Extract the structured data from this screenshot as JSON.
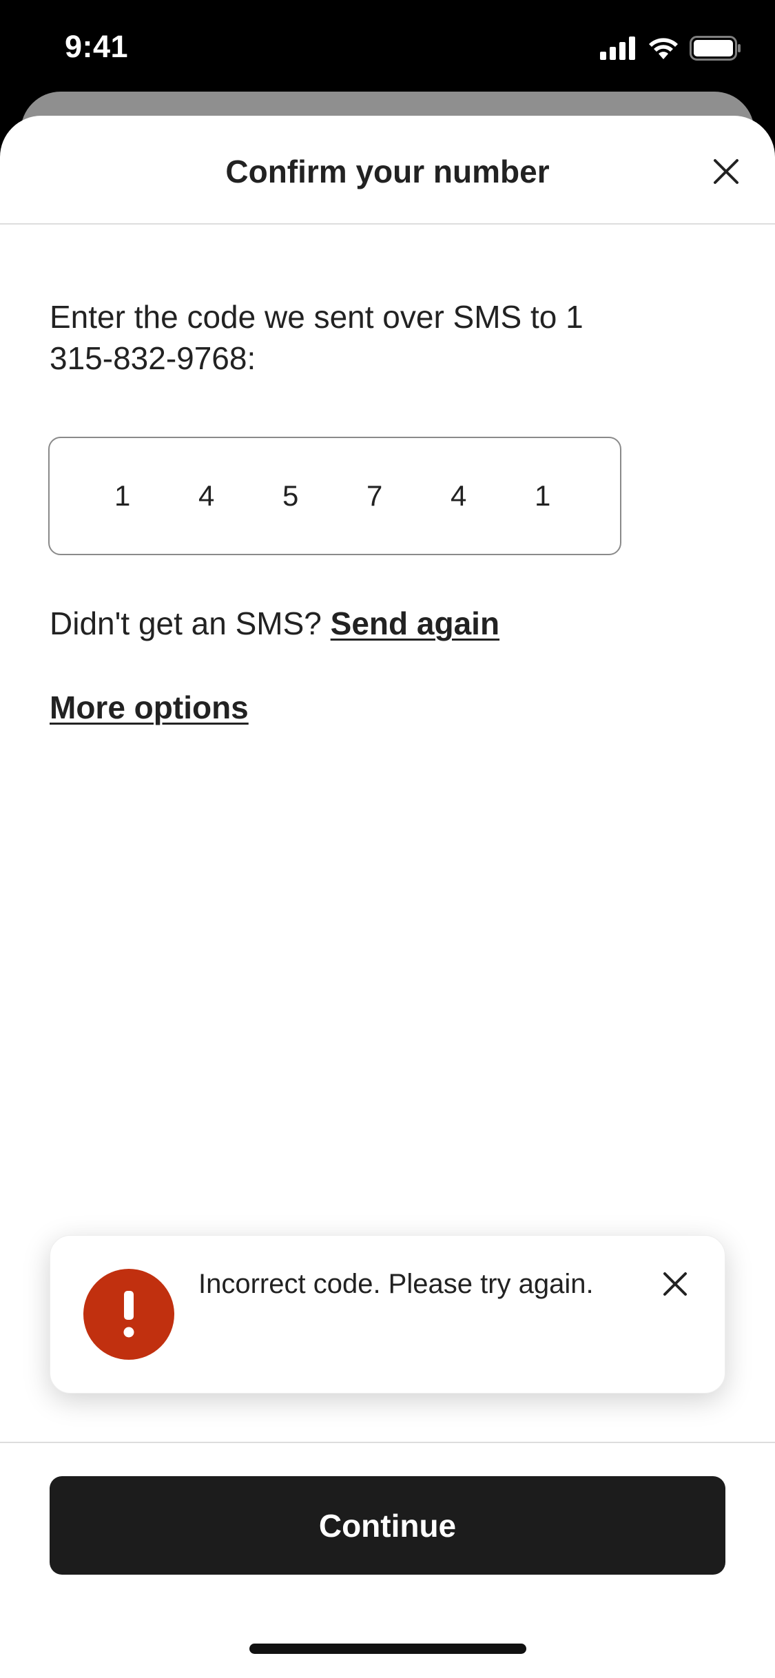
{
  "status_bar": {
    "time": "9:41",
    "icons": [
      "signal-icon",
      "wifi-icon",
      "battery-icon"
    ]
  },
  "header": {
    "title": "Confirm your number",
    "close_icon": "close-icon"
  },
  "instruction": {
    "line1": "Enter the code we sent over SMS to 1",
    "line2": "315-832-9768:"
  },
  "code_input": {
    "digits": [
      "1",
      "4",
      "5",
      "7",
      "4",
      "1"
    ]
  },
  "resend": {
    "prompt": "Didn't get an SMS?",
    "link": "Send again"
  },
  "more_options": "More options",
  "error_toast": {
    "icon": "alert-icon",
    "message": "Incorrect code. Please try again.",
    "close_icon": "close-icon",
    "color": "#c1300f"
  },
  "footer": {
    "continue_label": "Continue"
  }
}
